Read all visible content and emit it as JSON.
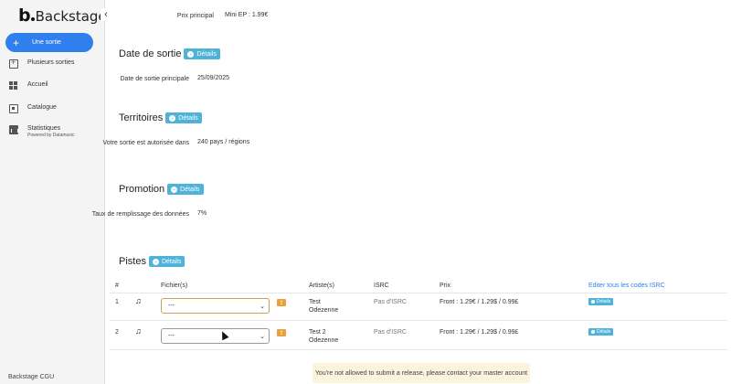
{
  "brand": {
    "logo_b": "b",
    "name": "Backstage"
  },
  "sidebar": {
    "new_release": "Une sortie",
    "items": [
      {
        "label": "Plusieurs sorties",
        "icon": "multi-release-icon"
      },
      {
        "label": "Accueil",
        "icon": "dashboard-icon"
      },
      {
        "label": "Catalogue",
        "icon": "catalog-icon"
      },
      {
        "label": "Statistiques",
        "sub": "Powered by Datamusic",
        "icon": "stats-icon"
      }
    ],
    "footer": "Backstage CGU"
  },
  "main": {
    "price": {
      "label": "Prix principal",
      "value": "Mini EP : 1.99€"
    },
    "details_label": "Détails",
    "sections": {
      "release_date": {
        "title": "Date de sortie",
        "label": "Date de sortie principale",
        "value": "25/09/2025"
      },
      "territories": {
        "title": "Territoires",
        "label": "Votre sortie est autorisée dans",
        "value": "240 pays / régions"
      },
      "promotion": {
        "title": "Promotion",
        "label": "Taux de remplissage des données",
        "value": "7%"
      },
      "tracks": {
        "title": "Pistes"
      }
    },
    "table": {
      "headers": {
        "num": "#",
        "files": "Fichier(s)",
        "artists": "Artiste(s)",
        "isrc": "ISRC",
        "price": "Prix",
        "edit_all": "Editer tous les codes ISRC"
      },
      "rows": [
        {
          "num": "1",
          "file": "---",
          "artist_line1": "Test",
          "artist_line2": "Odezenne",
          "isrc": "Pas d'ISRC",
          "price": "Front : 1.29€ / 1.29$ / 0.99£",
          "details": "Détails"
        },
        {
          "num": "2",
          "file": "---",
          "artist_line1": "Test 2",
          "artist_line2": "Odezenne",
          "isrc": "Pas d'ISRC",
          "price": "Front : 1.29€ / 1.29$ / 0.99£",
          "details": "Détails"
        }
      ]
    },
    "toast": "You're not allowed to submit a release, please contact your master account"
  }
}
